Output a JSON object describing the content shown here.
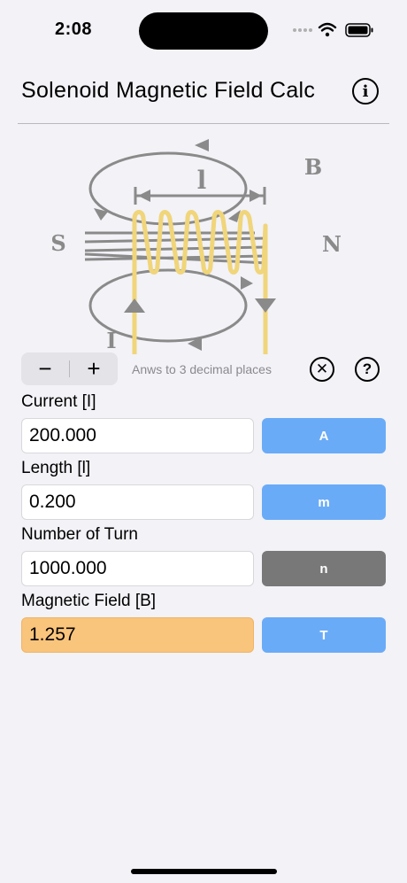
{
  "status": {
    "time": "2:08"
  },
  "nav": {
    "title": "Solenoid Magnetic Field Calc",
    "info_glyph": "i"
  },
  "diagram": {
    "label_length": "l",
    "label_field": "B",
    "label_south": "S",
    "label_north": "N",
    "label_current": "I"
  },
  "controls": {
    "minus": "−",
    "plus": "+",
    "decimal_note": "Anws to 3 decimal places",
    "clear_glyph": "✕",
    "help_glyph": "?"
  },
  "fields": [
    {
      "label": "Current [I]",
      "value": "200.000",
      "unit": "A",
      "unit_color": "#6aabf7"
    },
    {
      "label": "Length [l]",
      "value": "0.200",
      "unit": "m",
      "unit_color": "#6aabf7"
    },
    {
      "label": "Number of Turn",
      "value": "1000.000",
      "unit": "n",
      "unit_color": "#787878"
    },
    {
      "label": "Magnetic Field [B]",
      "value": "1.257",
      "unit": "T",
      "unit_color": "#6aabf7",
      "result_color": "#f9c47c"
    }
  ],
  "colors": {
    "background": "#f2f2f7",
    "coil": "#f0d57a",
    "field_lines": "#8a8a8a"
  }
}
